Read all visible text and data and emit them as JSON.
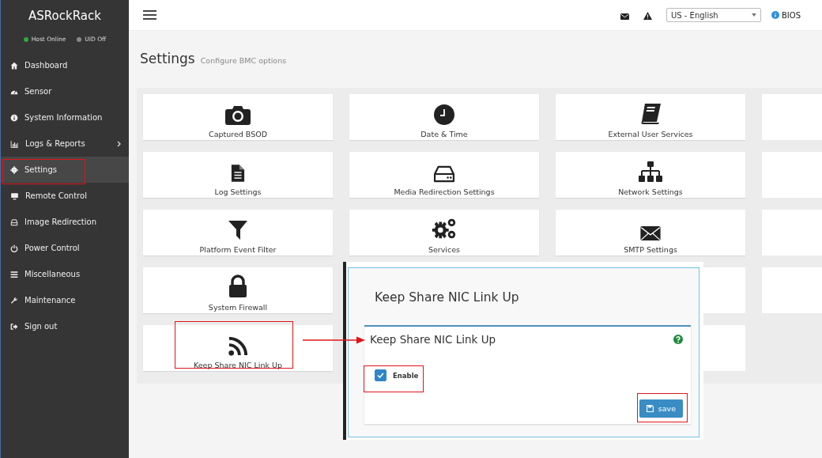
{
  "sidebar": {
    "brand": "ASRockRack",
    "status": [
      {
        "label": "Host Online",
        "color": "#2eaa3c"
      },
      {
        "label": "UID Off",
        "color": "#8a8a8a"
      }
    ],
    "items": [
      {
        "label": "Dashboard",
        "selected": false
      },
      {
        "label": "Sensor",
        "selected": false
      },
      {
        "label": "System Information",
        "selected": false
      },
      {
        "label": "Logs & Reports",
        "selected": false,
        "has_children": true
      },
      {
        "label": "Settings",
        "selected": true
      },
      {
        "label": "Remote Control",
        "selected": false
      },
      {
        "label": "Image Redirection",
        "selected": false
      },
      {
        "label": "Power Control",
        "selected": false
      },
      {
        "label": "Miscellaneous",
        "selected": false
      },
      {
        "label": "Maintenance",
        "selected": false
      },
      {
        "label": "Sign out",
        "selected": false
      }
    ]
  },
  "topbar": {
    "language": "US - English",
    "bios_link": "BIOS"
  },
  "page": {
    "title": "Settings",
    "subtitle": "Configure BMC options"
  },
  "cards": [
    {
      "kind": "item",
      "label": "Captured BSOD"
    },
    {
      "kind": "item",
      "label": "Date & Time"
    },
    {
      "kind": "item",
      "label": "External User Services"
    },
    {
      "kind": "blank"
    },
    {
      "kind": "item",
      "label": "Log Settings"
    },
    {
      "kind": "item",
      "label": "Media Redirection Settings"
    },
    {
      "kind": "item",
      "label": "Network Settings"
    },
    {
      "kind": "blank"
    },
    {
      "kind": "item",
      "label": "Platform Event Filter"
    },
    {
      "kind": "item",
      "label": "Services"
    },
    {
      "kind": "item",
      "label": "SMTP Settings"
    },
    {
      "kind": "blank"
    },
    {
      "kind": "item",
      "label": "System Firewall"
    },
    {
      "kind": "covered"
    },
    {
      "kind": "blank"
    },
    {
      "kind": "blank"
    },
    {
      "kind": "item",
      "label": "Keep Share NIC Link Up"
    },
    {
      "kind": "covered"
    },
    {
      "kind": "blank"
    }
  ],
  "dialog": {
    "title": "Keep Share NIC Link Up",
    "panel_title": "Keep Share NIC Link Up",
    "checkbox": {
      "label": "Enable",
      "checked": true
    },
    "save_button": "save"
  }
}
